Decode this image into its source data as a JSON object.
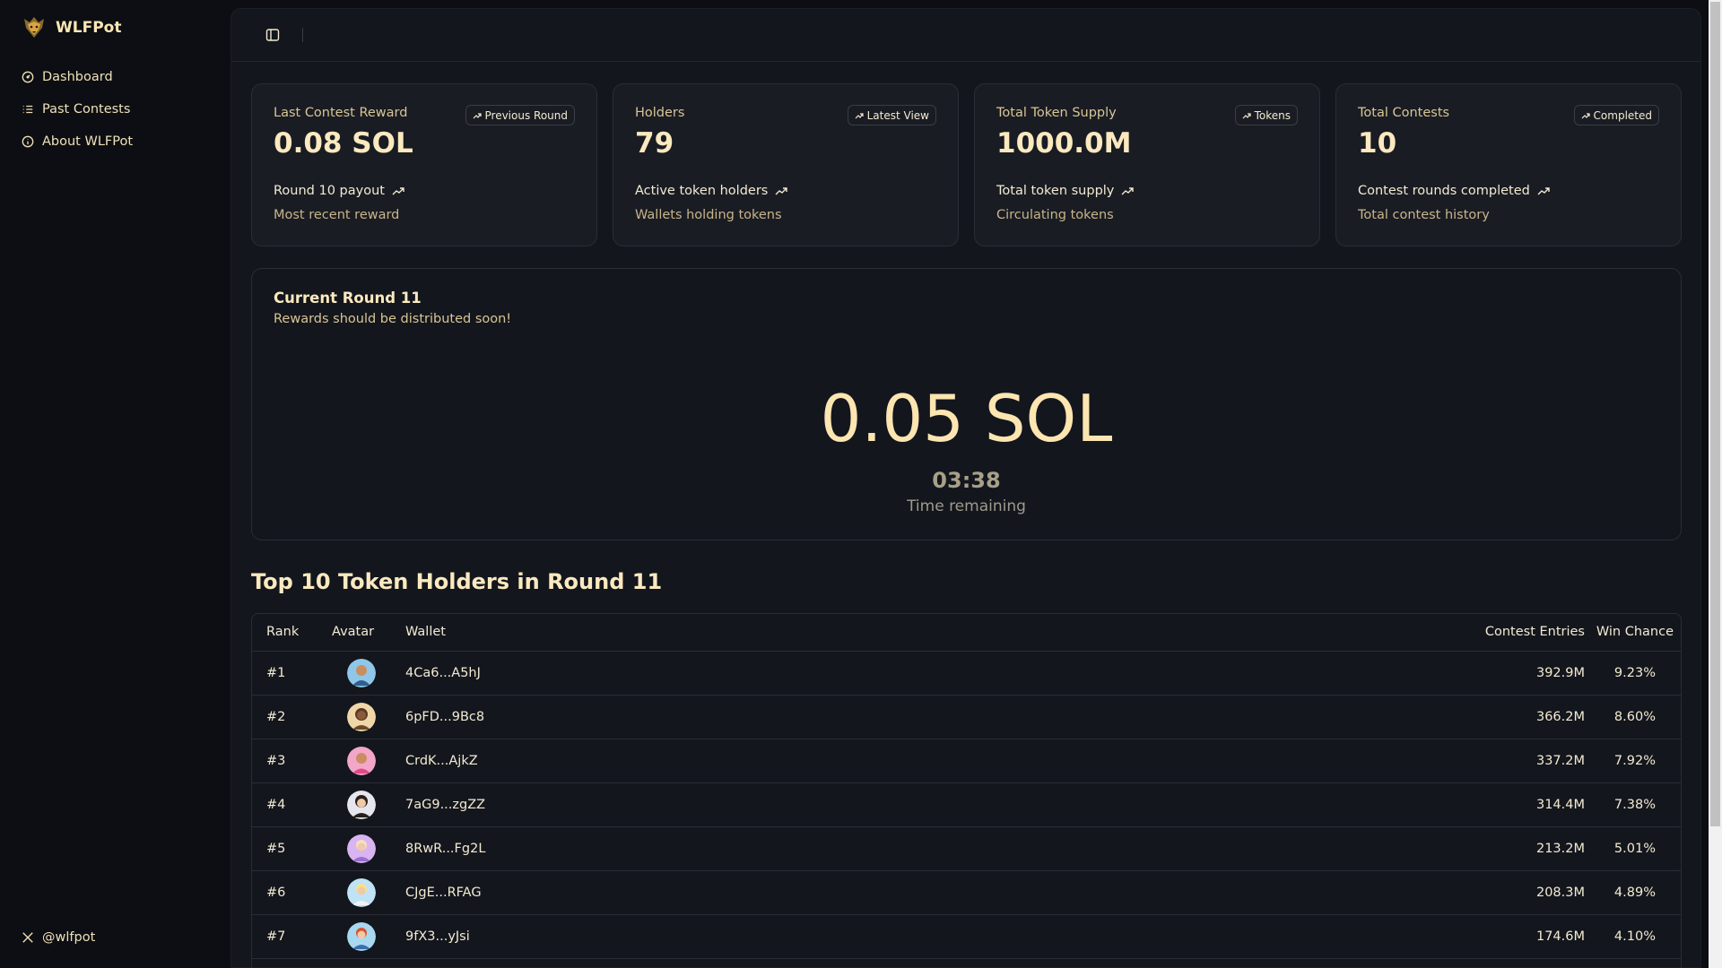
{
  "app": {
    "name": "WLFPot"
  },
  "sidebar": {
    "items": [
      {
        "label": "Dashboard",
        "icon": "gauge-icon"
      },
      {
        "label": "Past Contests",
        "icon": "list-icon"
      },
      {
        "label": "About WLFPot",
        "icon": "info-icon"
      }
    ],
    "social_label": "@wlfpot"
  },
  "cards": [
    {
      "title": "Last Contest Reward",
      "value": "0.08 SOL",
      "badge": "Previous Round",
      "footer1": "Round 10 payout",
      "footer2": "Most recent reward"
    },
    {
      "title": "Holders",
      "value": "79",
      "badge": "Latest View",
      "footer1": "Active token holders",
      "footer2": "Wallets holding tokens"
    },
    {
      "title": "Total Token Supply",
      "value": "1000.0M",
      "badge": "Tokens",
      "footer1": "Total token supply",
      "footer2": "Circulating tokens"
    },
    {
      "title": "Total Contests",
      "value": "10",
      "badge": "Completed",
      "footer1": "Contest rounds completed",
      "footer2": "Total contest history"
    }
  ],
  "round": {
    "title": "Current Round 11",
    "subtitle": "Rewards should be distributed soon!",
    "pot": "0.05 SOL",
    "timer": "03:38",
    "timer_label": "Time remaining"
  },
  "holders": {
    "title": "Top 10 Token Holders in Round 11",
    "columns": {
      "rank": "Rank",
      "avatar": "Avatar",
      "wallet": "Wallet",
      "entries": "Contest Entries",
      "chance": "Win Chance"
    },
    "rows": [
      {
        "rank": "#1",
        "wallet": "4Ca6...A5hJ",
        "entries": "392.9M",
        "chance": "9.23%"
      },
      {
        "rank": "#2",
        "wallet": "6pFD...9Bc8",
        "entries": "366.2M",
        "chance": "8.60%"
      },
      {
        "rank": "#3",
        "wallet": "CrdK...AjkZ",
        "entries": "337.2M",
        "chance": "7.92%"
      },
      {
        "rank": "#4",
        "wallet": "7aG9...zgZZ",
        "entries": "314.4M",
        "chance": "7.38%"
      },
      {
        "rank": "#5",
        "wallet": "8RwR...Fg2L",
        "entries": "213.2M",
        "chance": "5.01%"
      },
      {
        "rank": "#6",
        "wallet": "CJgE...RFAG",
        "entries": "208.3M",
        "chance": "4.89%"
      },
      {
        "rank": "#7",
        "wallet": "9fX3...yJsi",
        "entries": "174.6M",
        "chance": "4.10%"
      }
    ]
  }
}
